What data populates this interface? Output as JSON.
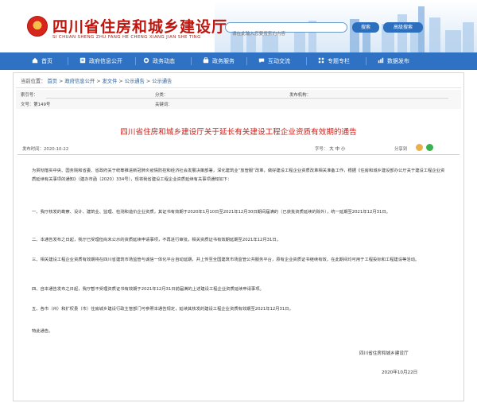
{
  "header": {
    "site_title": "四川省住房和城乡建设厅",
    "site_subtitle": "SI CHUAN SHENG ZHU FANG HE CHENG XIANG JIAN SHE TING",
    "search": {
      "placeholder": "请在此输入您要搜索的内容",
      "button_label": "搜索",
      "advanced_label": "高级搜索"
    }
  },
  "nav": {
    "items": [
      {
        "label": "首页",
        "icon": "home-icon"
      },
      {
        "label": "政府信息公开",
        "icon": "info-icon"
      },
      {
        "label": "政务动态",
        "icon": "news-icon"
      },
      {
        "label": "政务服务",
        "icon": "service-icon"
      },
      {
        "label": "互动交流",
        "icon": "chat-icon"
      },
      {
        "label": "专题专栏",
        "icon": "topic-icon"
      },
      {
        "label": "数据发布",
        "icon": "data-icon"
      }
    ]
  },
  "breadcrumb": {
    "prefix": "当前位置：",
    "items": [
      "首页",
      "政府信息公开",
      "发文件",
      "公示通告",
      "公示通告"
    ],
    "separator": " > "
  },
  "meta": {
    "index_label": "索引号：",
    "index_value": "",
    "category_label": "分类：",
    "category_value": "",
    "issuer_label": "发布机构：",
    "issuer_value": "",
    "docno_label": "文号：",
    "docno_value": "第149号",
    "keywords_label": "关键词：",
    "keywords_value": ""
  },
  "article": {
    "title": "四川省住房和城乡建设厅关于延长有关建设工程企业资质有效期的通告",
    "publish_label": "发布时间：",
    "publish_date": "2020-10-22",
    "font_size_label": "字号：",
    "font_sizes": [
      "大",
      "中",
      "小"
    ],
    "share_label": "分享到",
    "paragraphs": [
      "为贯彻落实中央、国务院和省委、省政府关于统筹推进新冠肺炎疫情防控和经济社会发展决策部署，深化建筑业“放管服”改革，做好建设工程企业资质改革相关准备工作，根据《住房和城乡建设部办公厅关于建设工程企业资质延续有关事项的通知》（建办市函〔2020〕334号），现将我省建设工程企业资质延续有关事项通知如下：",
      "一、我厅核发的勘察、设计、建筑业、监理、检测和造价企业资质，其证书有效期于2020年1月10日至2021年12月30日期间届满的（已获批资质延续的除外），统一延期至2021年12月31日。",
      "二、本通告发布之日起，我厅已受理但尚未公示的资质延续申请事项，不再进行审批，相关资质证书有效期延期至2021年12月31日。",
      "三、相关建设工程企业资质有效期将在四川省建筑市场监管与诚信一体化平台自动延期，并上传至全国建筑市场监管公共服务平台，原有企业资质证书继续有效，在此期间均可用于工程投标和工程建设等活动。",
      "四、自本通告发布之日起，我厅暂不受理资质证书有效期于2021年12月31日前届满的上述建设工程企业资质延续申请事项。",
      "五、各市（州）和扩权县（市）住房城乡建设行政主管部门可参照本通告规定，延续其核发的建设工程企业资质有效期至2021年12月31日。",
      "特此通告。"
    ],
    "signature": "四川省住房和城乡建设厅",
    "sign_date": "2020年10月22日"
  },
  "colors": {
    "brand_red": "#c0140c",
    "nav_blue": "#2f72c3",
    "title_red": "#d0211b"
  }
}
